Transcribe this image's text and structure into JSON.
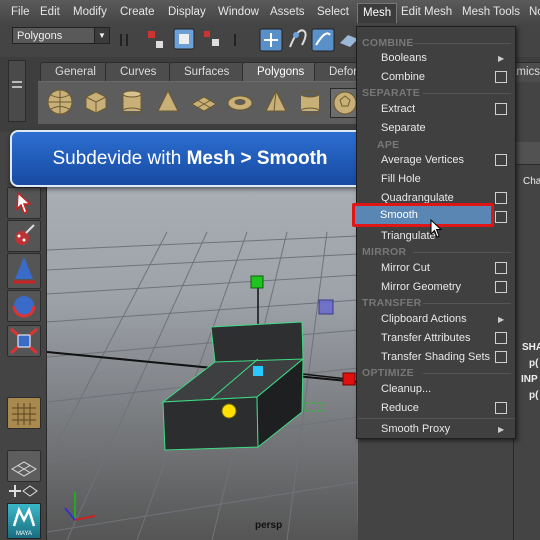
{
  "menubar": {
    "items": [
      "File",
      "Edit",
      "Modify",
      "Create",
      "Display",
      "Window",
      "Assets",
      "Select",
      "Mesh",
      "Edit Mesh",
      "Mesh Tools",
      "No"
    ],
    "active": "Mesh"
  },
  "statusline": {
    "mode": "Polygons"
  },
  "shelf": {
    "tabs": [
      "General",
      "Curves",
      "Surfaces",
      "Polygons",
      "Defor"
    ],
    "right_tab": "amics",
    "active_tab": "Polygons"
  },
  "banner": {
    "prefix": "Subdevide with ",
    "bold": "Mesh > Smooth"
  },
  "mesh_menu": {
    "combine_header": "COMBINE",
    "booleans": "Booleans",
    "combine": "Combine",
    "separate_header": "SEPARATE",
    "extract": "Extract",
    "separate": "Separate",
    "shape_header": "APE",
    "average_vertices": "Average Vertices",
    "fill_hole": "Fill Hole",
    "quadrangulate": "Quadrangulate",
    "smooth": "Smooth",
    "triangulate": "Triangulate",
    "mirror_header": "MIRROR",
    "mirror_cut": "Mirror Cut",
    "mirror_geometry": "Mirror Geometry",
    "transfer_header": "TRANSFER",
    "clipboard_actions": "Clipboard Actions",
    "transfer_attributes": "Transfer Attributes",
    "transfer_shading_sets": "Transfer Shading Sets",
    "optimize_header": "OPTIMIZE",
    "cleanup": "Cleanup...",
    "reduce": "Reduce",
    "smooth_proxy": "Smooth Proxy"
  },
  "viewport": {
    "camera_label": "persp"
  },
  "right_panel": {
    "cha": "Cha",
    "sha": "SHA",
    "p1": "p(",
    "inp": "INP",
    "p2": "p("
  },
  "toolbox": {
    "logo_text": "MAYA"
  },
  "colors": {
    "menu_highlight": "#5a86b4",
    "highlight_border": "#e01515",
    "banner_blue": "#2d6fd0",
    "selection_green": "#3ddc84",
    "vertex_yellow": "#ffe000"
  }
}
